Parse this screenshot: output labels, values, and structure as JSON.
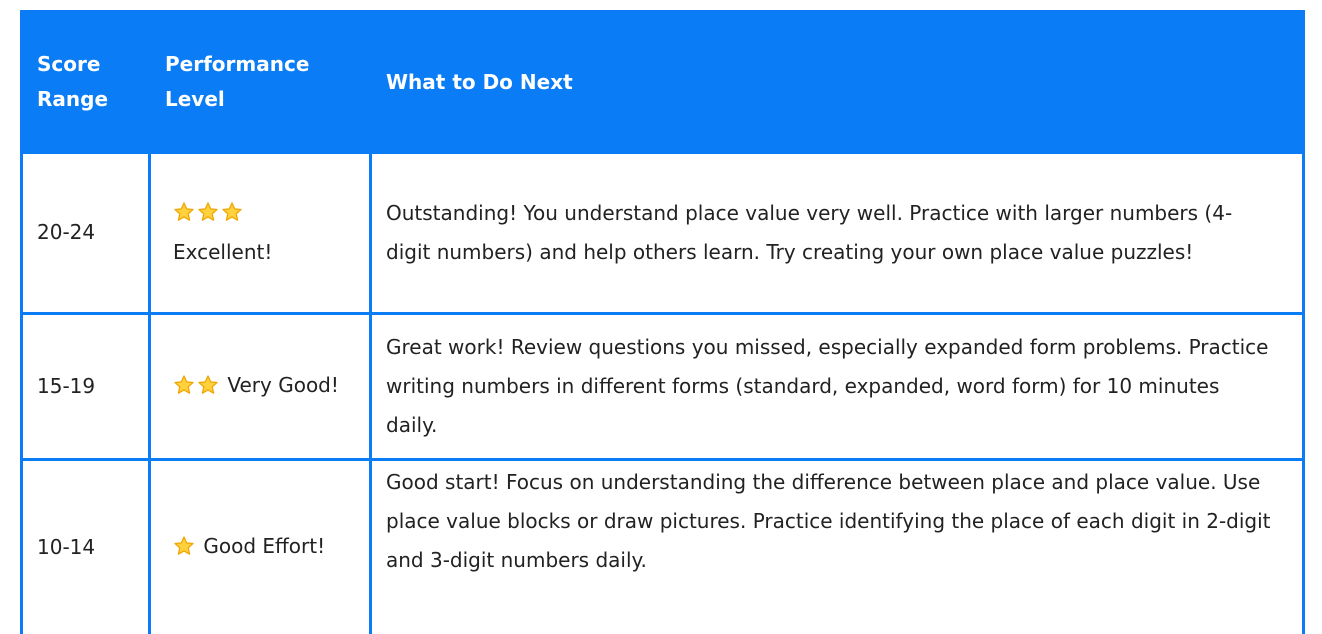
{
  "header": {
    "col1": "Score Range",
    "col2": "Performance Level",
    "col3": "What to Do Next"
  },
  "colors": {
    "accent": "#0a7cf5",
    "star_fill": "#ffd23d",
    "star_stroke": "#f0a500"
  },
  "rows": [
    {
      "score": "20-24",
      "stars": 3,
      "level": "Excellent!",
      "next": "Outstanding! You understand place value very well. Practice with larger numbers (4-digit numbers) and help others learn. Try creating your own place value puzzles!"
    },
    {
      "score": "15-19",
      "stars": 2,
      "level": "Very Good!",
      "next": "Great work! Review questions you missed, especially expanded form problems. Practice writing numbers in different forms (standard, expanded, word form) for 10 minutes daily."
    },
    {
      "score": "10-14",
      "stars": 1,
      "level": "Good Effort!",
      "next": "Good start! Focus on understanding the difference between place and place value. Use place value blocks or draw pictures. Practice identifying the place of each digit in 2-digit and 3-digit numbers daily."
    }
  ]
}
